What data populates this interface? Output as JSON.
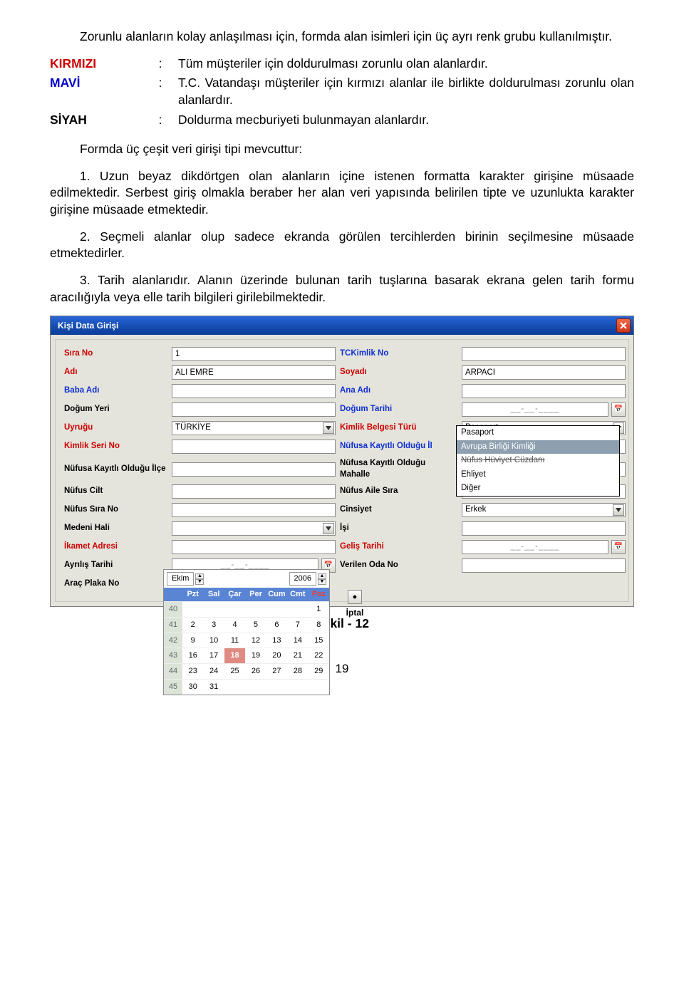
{
  "doc": {
    "intro": "Zorunlu alanların kolay anlaşılması için, formda alan isimleri için üç ayrı renk grubu kullanılmıştır.",
    "legend": {
      "kirmizi": {
        "label": "KIRMIZI",
        "colon": ":",
        "text": "Tüm müşteriler için doldurulması zorunlu olan alanlardır."
      },
      "mavi": {
        "label": "MAVİ",
        "colon": ":",
        "text": "T.C. Vatandaşı müşteriler için kırmızı alanlar ile birlikte doldurulması zorunlu olan alanlardır."
      },
      "siyah": {
        "label": "SİYAH",
        "colon": ":",
        "text": "Doldurma mecburiyeti bulunmayan alanlardır."
      }
    },
    "types_intro": "Formda üç çeşit veri girişi tipi mevcuttur:",
    "item1": "1. Uzun beyaz dikdörtgen olan alanların içine istenen formatta karakter girişine müsaade edilmektedir. Serbest giriş olmakla beraber her alan veri yapısında belirilen tipte ve uzunlukta karakter girişine müsaade etmektedir.",
    "item2": "2. Seçmeli alanlar olup sadece ekranda görülen tercihlerden birinin seçilmesine müsaade etmektedirler.",
    "item3": "3. Tarih alanlarıdır. Alanın üzerinde bulunan tarih tuşlarına basarak ekrana gelen tarih formu aracılığıyla veya elle tarih bilgileri girilebilmektedir.",
    "caption": "Şekil - 12",
    "page": "19"
  },
  "win": {
    "title": "Kişi Data Girişi",
    "labels": {
      "sira_no": "Sıra No",
      "tckimlik": "TCKimlik No",
      "adi": "Adı",
      "soyadi": "Soyadı",
      "baba_adi": "Baba Adı",
      "ana_adi": "Ana Adı",
      "dogum_yeri": "Doğum Yeri",
      "dogum_tarihi": "Doğum Tarihi",
      "uyrugu": "Uyruğu",
      "kimlik_turu": "Kimlik Belgesi Türü",
      "kimlik_seri": "Kimlik Seri No",
      "nufus_il": "Nüfusa Kayıtlı Olduğu İl",
      "nufus_ilce": "Nüfusa Kayıtlı Olduğu İlçe",
      "nufus_mah": "Nüfusa Kayıtlı Olduğu Mahalle",
      "nufus_cilt": "Nüfus Cilt",
      "nufus_aile": "Nüfus Aile Sıra",
      "nufus_sira": "Nüfus Sıra No",
      "cinsiyet": "Cinsiyet",
      "medeni": "Medeni Hali",
      "isi": "İşi",
      "ikamet": "İkamet Adresi",
      "gelis": "Geliş Tarihi",
      "ayrilis": "Ayrılış Tarihi",
      "oda": "Verilen Oda No",
      "plaka": "Araç Plaka No"
    },
    "values": {
      "sira_no": "1",
      "adi": "ALİ EMRE",
      "soyadi": "ARPACI",
      "uyrugu": "TÜRKİYE",
      "kimlik_turu": "Pasaport",
      "cinsiyet": "Erkek",
      "date_placeholder": "__-__-____"
    },
    "dropdown_options": [
      "Pasaport",
      "Avrupa Birliği Kimliği",
      "Nüfus Hüviyet Cüzdanı",
      "Ehliyet",
      "Diğer"
    ],
    "calendar": {
      "month": "Ekim",
      "year": "2006",
      "day_headers": [
        "Pzt",
        "Sal",
        "Çar",
        "Per",
        "Cum",
        "Cmt",
        "Paz"
      ],
      "weeks": [
        {
          "wk": "40",
          "days": [
            "",
            "",
            "",
            "",
            "",
            "",
            "1"
          ]
        },
        {
          "wk": "41",
          "days": [
            "2",
            "3",
            "4",
            "5",
            "6",
            "7",
            "8"
          ]
        },
        {
          "wk": "42",
          "days": [
            "9",
            "10",
            "11",
            "12",
            "13",
            "14",
            "15"
          ]
        },
        {
          "wk": "43",
          "days": [
            "16",
            "17",
            "18",
            "19",
            "20",
            "21",
            "22"
          ]
        },
        {
          "wk": "44",
          "days": [
            "23",
            "24",
            "25",
            "26",
            "27",
            "28",
            "29"
          ]
        },
        {
          "wk": "45",
          "days": [
            "30",
            "31",
            "",
            "",
            "",
            "",
            ""
          ]
        }
      ],
      "today": "18",
      "cancel": "İptal"
    }
  }
}
